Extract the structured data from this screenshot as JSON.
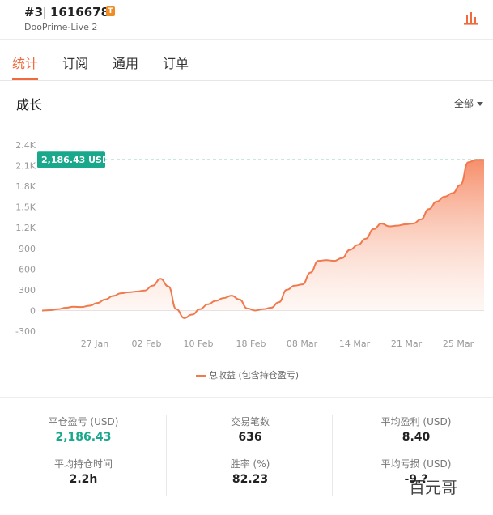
{
  "header": {
    "rank": "#3",
    "account": "1616678",
    "badge": "T",
    "server": "DooPrime-Live 2",
    "chart_icon": "bar-chart-icon"
  },
  "tabs": [
    {
      "label": "统计",
      "active": true
    },
    {
      "label": "订阅",
      "active": false
    },
    {
      "label": "通用",
      "active": false
    },
    {
      "label": "订单",
      "active": false
    }
  ],
  "section": {
    "title": "成长",
    "filter": "全部"
  },
  "chart_data": {
    "type": "area",
    "title": "",
    "xlabel": "",
    "ylabel": "",
    "ylim": [
      -300,
      2400
    ],
    "y_ticks": [
      "2.4K",
      "2.1K",
      "1.8K",
      "1.5K",
      "1.2K",
      "900",
      "600",
      "300",
      "0",
      "-300"
    ],
    "x_ticks": [
      "27 Jan",
      "02 Feb",
      "10 Feb",
      "18 Feb",
      "08 Mar",
      "14 Mar",
      "21 Mar",
      "25 Mar"
    ],
    "current_value_label": "2,186.43 USD",
    "current_value": 2186.43,
    "series": [
      {
        "name": "总收益 (包含持仓盈亏)",
        "color": "#f07a4e",
        "values": [
          0,
          5,
          20,
          40,
          55,
          50,
          70,
          110,
          160,
          210,
          250,
          265,
          275,
          290,
          360,
          460,
          350,
          20,
          -110,
          -60,
          20,
          90,
          140,
          180,
          215,
          160,
          30,
          0,
          20,
          40,
          120,
          300,
          360,
          380,
          550,
          720,
          730,
          720,
          760,
          880,
          950,
          1040,
          1180,
          1260,
          1220,
          1230,
          1250,
          1260,
          1320,
          1470,
          1580,
          1650,
          1700,
          1820,
          2150,
          2186,
          2186
        ]
      }
    ],
    "grid": false,
    "legend": "bottom"
  },
  "stats": {
    "closed_pnl_label": "平仓盈亏 (USD)",
    "closed_pnl_value": "2,186.43",
    "avg_hold_label": "平均持仓时间",
    "avg_hold_value": "2.2h",
    "trades_label": "交易笔数",
    "trades_value": "636",
    "winrate_label": "胜率 (%)",
    "winrate_value": "82.23",
    "avg_profit_label": "平均盈利 (USD)",
    "avg_profit_value": "8.40",
    "avg_loss_label": "平均亏损 (USD)",
    "avg_loss_value": "-9.?"
  },
  "watermark": "百元哥",
  "colors": {
    "accent": "#f06a3d",
    "line": "#f07a4e",
    "teal": "#1aa88c"
  }
}
